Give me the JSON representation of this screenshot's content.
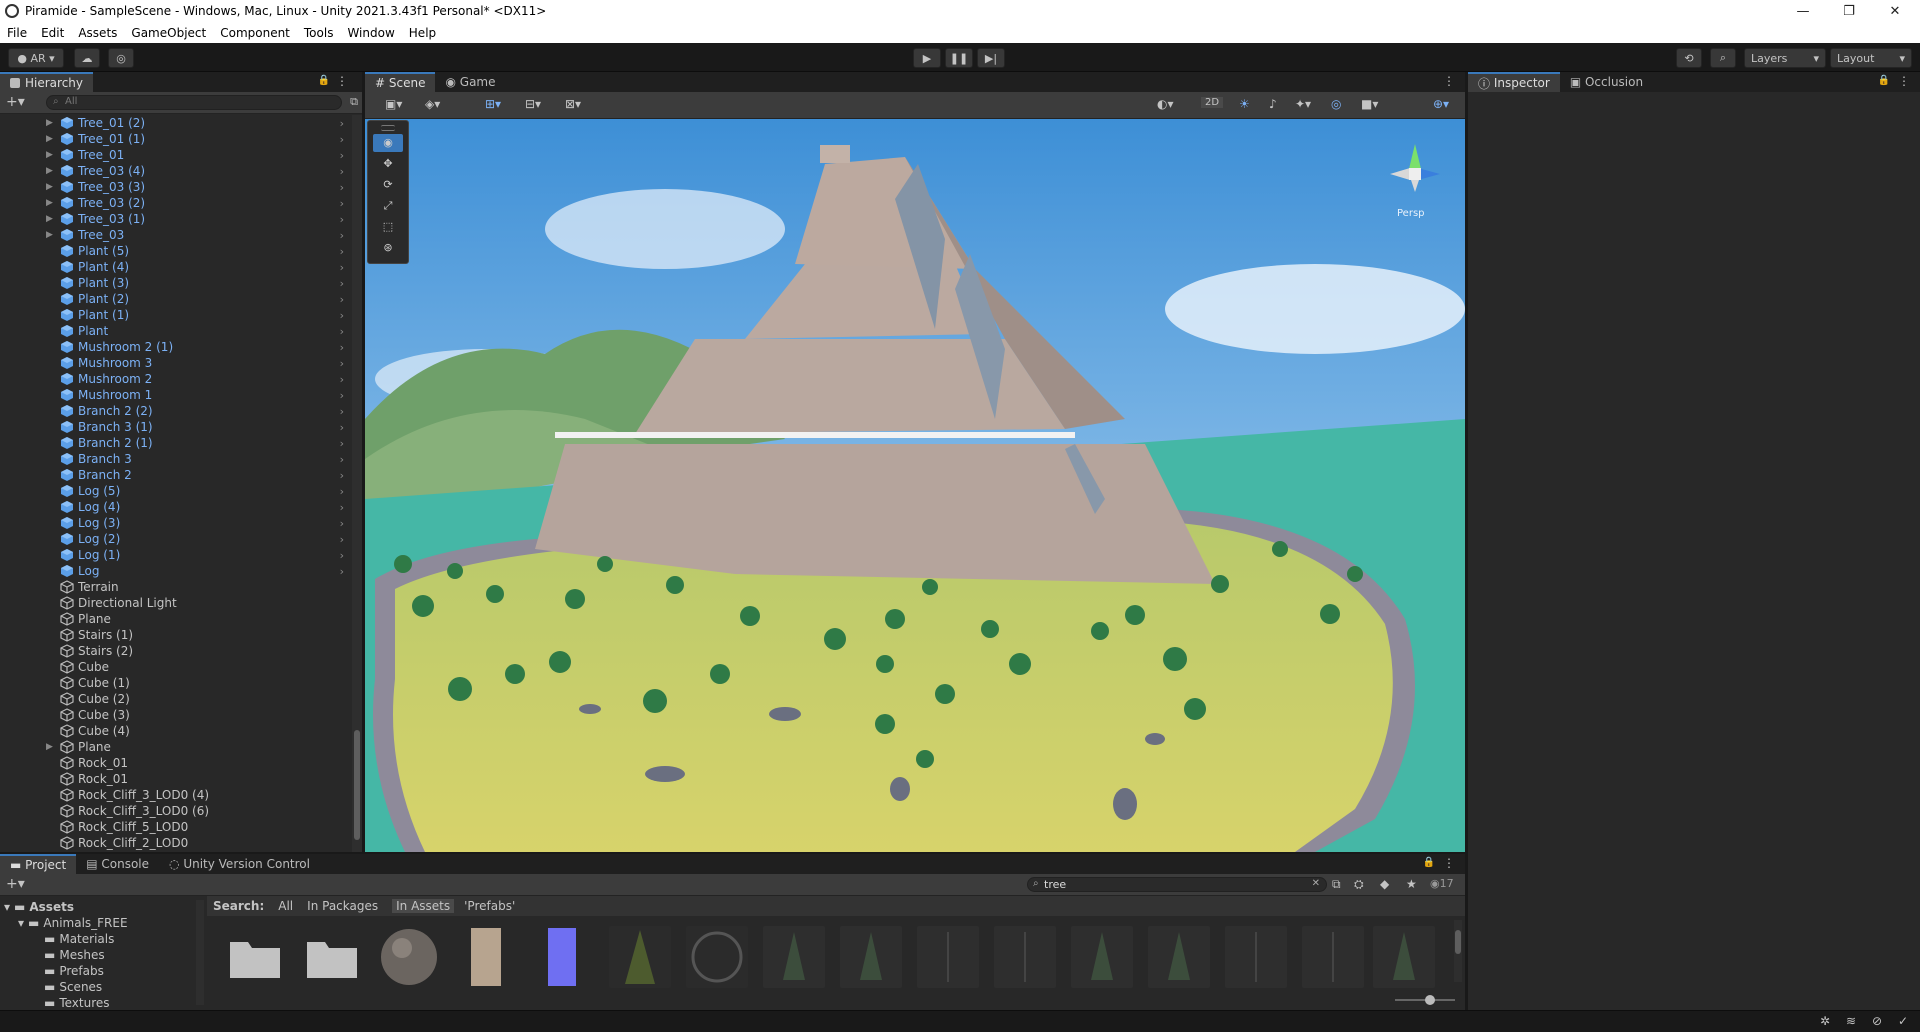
{
  "window": {
    "title": "Piramide - SampleScene - Windows, Mac, Linux - Unity 2021.3.43f1 Personal* <DX11>"
  },
  "menu": [
    "File",
    "Edit",
    "Assets",
    "GameObject",
    "Component",
    "Tools",
    "Window",
    "Help"
  ],
  "toolbar": {
    "account": "AR",
    "layers": "Layers",
    "layout": "Layout"
  },
  "hierarchy": {
    "title": "Hierarchy",
    "search_placeholder": "All",
    "items": [
      {
        "label": "Tree_01 (2)",
        "prefab": true,
        "expand": true
      },
      {
        "label": "Tree_01 (1)",
        "prefab": true,
        "expand": true
      },
      {
        "label": "Tree_01",
        "prefab": true,
        "expand": true
      },
      {
        "label": "Tree_03 (4)",
        "prefab": true,
        "expand": true
      },
      {
        "label": "Tree_03 (3)",
        "prefab": true,
        "expand": true
      },
      {
        "label": "Tree_03 (2)",
        "prefab": true,
        "expand": true
      },
      {
        "label": "Tree_03 (1)",
        "prefab": true,
        "expand": true
      },
      {
        "label": "Tree_03",
        "prefab": true,
        "expand": true
      },
      {
        "label": "Plant (5)",
        "prefab": true,
        "expand": false
      },
      {
        "label": "Plant (4)",
        "prefab": true,
        "expand": false
      },
      {
        "label": "Plant (3)",
        "prefab": true,
        "expand": false
      },
      {
        "label": "Plant (2)",
        "prefab": true,
        "expand": false
      },
      {
        "label": "Plant (1)",
        "prefab": true,
        "expand": false
      },
      {
        "label": "Plant",
        "prefab": true,
        "expand": false
      },
      {
        "label": "Mushroom 2 (1)",
        "prefab": true,
        "expand": false
      },
      {
        "label": "Mushroom 3",
        "prefab": true,
        "expand": false
      },
      {
        "label": "Mushroom 2",
        "prefab": true,
        "expand": false
      },
      {
        "label": "Mushroom 1",
        "prefab": true,
        "expand": false
      },
      {
        "label": "Branch 2 (2)",
        "prefab": true,
        "expand": false
      },
      {
        "label": "Branch 3 (1)",
        "prefab": true,
        "expand": false
      },
      {
        "label": "Branch 2 (1)",
        "prefab": true,
        "expand": false
      },
      {
        "label": "Branch 3",
        "prefab": true,
        "expand": false
      },
      {
        "label": "Branch 2",
        "prefab": true,
        "expand": false
      },
      {
        "label": "Log (5)",
        "prefab": true,
        "expand": false
      },
      {
        "label": "Log (4)",
        "prefab": true,
        "expand": false
      },
      {
        "label": "Log (3)",
        "prefab": true,
        "expand": false
      },
      {
        "label": "Log (2)",
        "prefab": true,
        "expand": false
      },
      {
        "label": "Log (1)",
        "prefab": true,
        "expand": false
      },
      {
        "label": "Log",
        "prefab": true,
        "expand": false
      },
      {
        "label": "Terrain",
        "prefab": false,
        "expand": false
      },
      {
        "label": "Directional Light",
        "prefab": false,
        "expand": false
      },
      {
        "label": "Plane",
        "prefab": false,
        "expand": false
      },
      {
        "label": "Stairs (1)",
        "prefab": false,
        "expand": false
      },
      {
        "label": "Stairs (2)",
        "prefab": false,
        "expand": false
      },
      {
        "label": "Cube",
        "prefab": false,
        "expand": false
      },
      {
        "label": "Cube (1)",
        "prefab": false,
        "expand": false
      },
      {
        "label": "Cube (2)",
        "prefab": false,
        "expand": false
      },
      {
        "label": "Cube (3)",
        "prefab": false,
        "expand": false
      },
      {
        "label": "Cube (4)",
        "prefab": false,
        "expand": false
      },
      {
        "label": "Plane",
        "prefab": false,
        "expand": true
      },
      {
        "label": "Rock_01",
        "prefab": false,
        "expand": false
      },
      {
        "label": "Rock_01",
        "prefab": false,
        "expand": false
      },
      {
        "label": "Rock_Cliff_3_LOD0 (4)",
        "prefab": false,
        "expand": false
      },
      {
        "label": "Rock_Cliff_3_LOD0 (6)",
        "prefab": false,
        "expand": false
      },
      {
        "label": "Rock_Cliff_5_LOD0",
        "prefab": false,
        "expand": false
      },
      {
        "label": "Rock_Cliff_2_LOD0",
        "prefab": false,
        "expand": false
      }
    ]
  },
  "scene": {
    "tabs": [
      "Scene",
      "Game"
    ],
    "mode_2d": "2D",
    "persp": "Persp"
  },
  "inspector": {
    "tabs": [
      "Inspector",
      "Occlusion"
    ]
  },
  "project": {
    "tabs": [
      "Project",
      "Console",
      "Unity Version Control"
    ],
    "search_value": "tree",
    "count": "17",
    "search_label": "Search:",
    "scopes": [
      "All",
      "In Packages",
      "In Assets",
      "'Prefabs'"
    ],
    "tree": [
      "Assets",
      "Animals_FREE",
      "Materials",
      "Meshes",
      "Prefabs",
      "Scenes",
      "Textures"
    ]
  }
}
